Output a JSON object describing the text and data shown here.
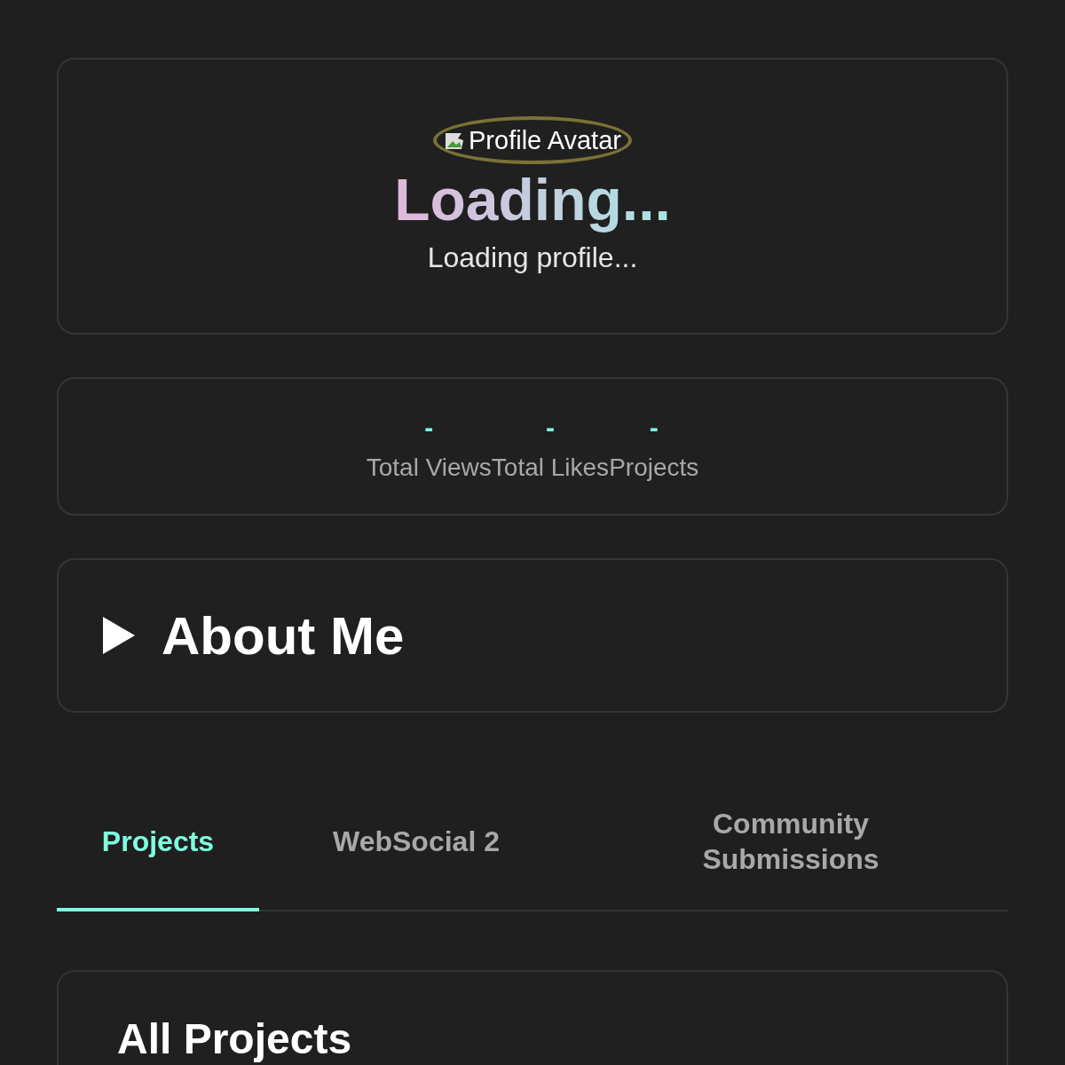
{
  "profile": {
    "avatar_alt": "Profile Avatar",
    "name": "Loading...",
    "status": "Loading profile..."
  },
  "stats": [
    {
      "value": "-",
      "label": "Total Views"
    },
    {
      "value": "-",
      "label": "Total Likes"
    },
    {
      "value": "-",
      "label": "Projects"
    }
  ],
  "about": {
    "title": "About Me",
    "expanded": false
  },
  "tabs": [
    {
      "label": "Projects",
      "selected": true
    },
    {
      "label": "WebSocial 2",
      "selected": false
    },
    {
      "label": "Community Submissions",
      "selected": false
    }
  ],
  "projects": {
    "heading": "All Projects"
  }
}
